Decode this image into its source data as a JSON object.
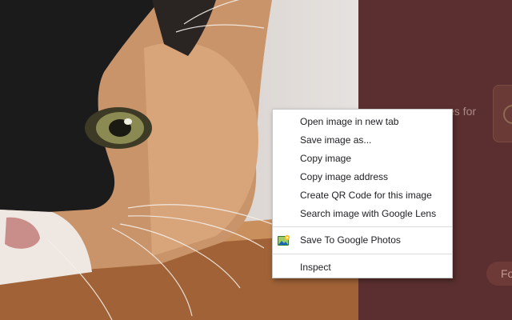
{
  "context_menu": {
    "items": [
      {
        "label": "Open image in new tab"
      },
      {
        "label": "Save image as..."
      },
      {
        "label": "Copy image"
      },
      {
        "label": "Copy image address"
      },
      {
        "label": "Create QR Code for this image"
      },
      {
        "label": "Search image with Google Lens"
      },
      {
        "label": "Save To Google Photos",
        "icon": "google-photos-extension-icon"
      },
      {
        "label": "Inspect"
      }
    ]
  },
  "background_page": {
    "partial_text": "es for",
    "partial_button_label": "Fo"
  },
  "colors": {
    "panel_background": "#5b2f2f",
    "menu_background": "#ffffff",
    "menu_text": "#202124",
    "separator": "#dadce0"
  }
}
